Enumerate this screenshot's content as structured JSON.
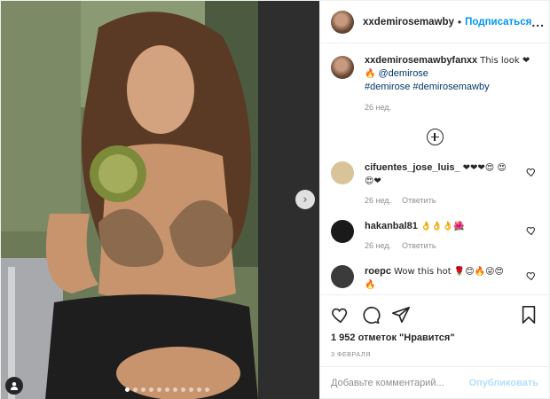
{
  "header": {
    "username": "xxdemirosemawby",
    "separator": "•",
    "follow_label": "Подписаться",
    "more_label": "..."
  },
  "caption": {
    "username": "xxdemirosemawbyfanxx",
    "text": "This look ❤ 🔥",
    "mention": "@demirose",
    "hashtags": "#demirose #demirosemawby",
    "time": "26 нед."
  },
  "comments": [
    {
      "username": "cifuentes_jose_luis_",
      "text": "❤❤❤😍 😍😍❤",
      "time": "26 нед.",
      "reply_label": "Ответить",
      "avatar_color": "#d9c49a"
    },
    {
      "username": "hakanbal81",
      "text": "👌👌👌🌺",
      "time": "26 нед.",
      "reply_label": "Ответить",
      "avatar_color": "#1a1a1a"
    },
    {
      "username": "roepc",
      "text": "Wow this hot 🌹😊🔥😜😍 🔥",
      "time": "",
      "reply_label": "",
      "avatar_color": "#3b3b3b"
    }
  ],
  "likes_text": "1 952 отметок \"Нравится\"",
  "date_text": "3 ФЕВРАЛЯ",
  "add_comment": {
    "placeholder": "Добавьте комментарий...",
    "publish_label": "Опубликовать"
  },
  "carousel": {
    "next_icon": "chevron-right",
    "slide_count": 11,
    "active_slide": 1
  },
  "icons": {
    "like": "heart-icon",
    "comment": "comment-icon",
    "share": "share-icon",
    "save": "bookmark-icon",
    "load_more": "plus-circle-icon",
    "tagged_user": "user-tag-icon"
  },
  "colors": {
    "link": "#00376b",
    "follow": "#0095f6",
    "publish_disabled": "#b2dffc",
    "muted": "#8e8e8e"
  }
}
